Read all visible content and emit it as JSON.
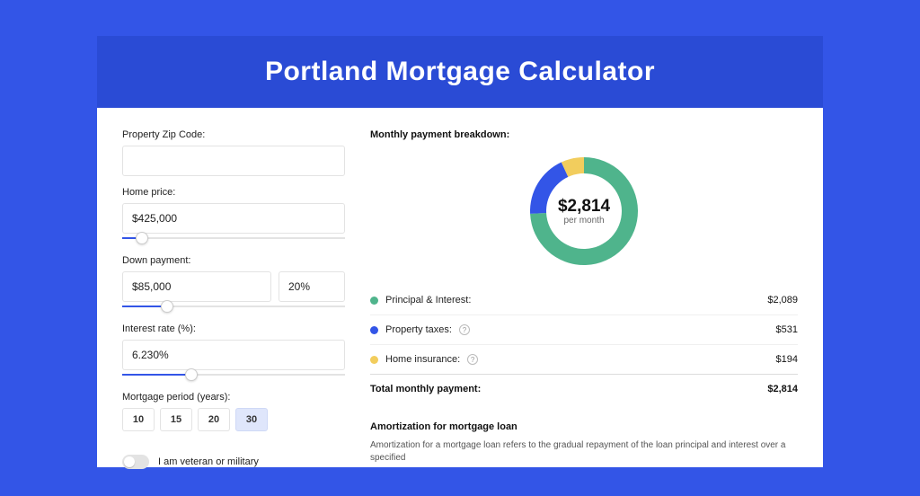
{
  "header": {
    "title": "Portland Mortgage Calculator"
  },
  "inputs": {
    "zip_label": "Property Zip Code:",
    "zip_value": "",
    "home_price_label": "Home price:",
    "home_price_value": "$425,000",
    "home_price_slider_pct": 9,
    "down_payment_label": "Down payment:",
    "down_payment_value": "$85,000",
    "down_payment_pct_value": "20%",
    "down_payment_slider_pct": 20,
    "interest_label": "Interest rate (%):",
    "interest_value": "6.230%",
    "interest_slider_pct": 31,
    "period_label": "Mortgage period (years):",
    "period_options": [
      "10",
      "15",
      "20",
      "30"
    ],
    "period_selected": "30",
    "veteran_label": "I am veteran or military",
    "veteran_checked": false
  },
  "breakdown": {
    "title": "Monthly payment breakdown:",
    "center_amount": "$2,814",
    "center_sub": "per month",
    "items": [
      {
        "label": "Principal & Interest:",
        "value": "$2,089",
        "color": "green",
        "help": false
      },
      {
        "label": "Property taxes:",
        "value": "$531",
        "color": "blue",
        "help": true
      },
      {
        "label": "Home insurance:",
        "value": "$194",
        "color": "yellow",
        "help": true
      }
    ],
    "total_label": "Total monthly payment:",
    "total_value": "$2,814"
  },
  "amortization": {
    "title": "Amortization for mortgage loan",
    "text": "Amortization for a mortgage loan refers to the gradual repayment of the loan principal and interest over a specified"
  },
  "chart_data": {
    "type": "pie",
    "title": "Monthly payment breakdown",
    "series": [
      {
        "name": "Principal & Interest",
        "value": 2089,
        "color": "#4fb48c"
      },
      {
        "name": "Property taxes",
        "value": 531,
        "color": "#3355e7"
      },
      {
        "name": "Home insurance",
        "value": 194,
        "color": "#f2cd5d"
      }
    ],
    "total": 2814,
    "center_label": "$2,814 per month"
  }
}
